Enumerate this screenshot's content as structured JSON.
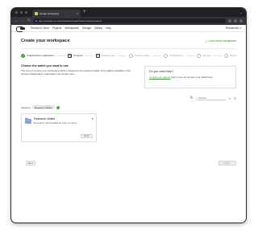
{
  "browser": {
    "tab_title": "Create workspace",
    "tab_close": "×",
    "new_tab": "+",
    "tab_menu": "⌄",
    "url": "app.example.com/workspaces/create?step=select-projects",
    "back": "←",
    "forward": "→",
    "reload": "↻"
  },
  "app": {
    "nav": [
      "Research Cloud",
      "Projects",
      "Workspaces",
      "Storage",
      "Gallery",
      "Help"
    ],
    "user": "Researcher",
    "user_caret": "▾"
  },
  "page": {
    "title": "Create your workspace",
    "help_link": "Learn about workspaces"
  },
  "stepper": {
    "steps": [
      {
        "label": "Collaborative organisation",
        "icon": "check",
        "state": "active"
      },
      {
        "label": "Projects",
        "icon": "grid",
        "state": "current"
      },
      {
        "label": "Catalog item",
        "icon": "",
        "state": "pending"
      },
      {
        "label": "Cloud provider",
        "icon": "",
        "state": "pending"
      },
      {
        "label": "Configuration",
        "icon": "",
        "state": "pending"
      },
      {
        "label": "Review",
        "icon": "",
        "state": "pending"
      },
      {
        "label": "Name",
        "icon": "",
        "state": "pending"
      }
    ]
  },
  "intro": {
    "title": "Choose the wallet you want to use",
    "text": "The cost of running your workspace will be charged to the selected wallet. Only wallets available in the chosen collaborative organisation are shown here."
  },
  "help": {
    "title": "Do you need help?",
    "link_text": "Contact our support",
    "text_after": " team if you do not see your wallet here."
  },
  "toolbar": {
    "refresh": "↻",
    "search_icon": "⌕",
    "search_text": "Search",
    "clear": "×",
    "filter": "⚲"
  },
  "selection": {
    "label": "Selected",
    "chip": "Research Wallet",
    "chip_remove": "×"
  },
  "card": {
    "title": "Research Wallet",
    "description": "Research Cloud wallet for team projects",
    "toggle": "▾",
    "button": "Select"
  },
  "footer": {
    "back": "Back",
    "next": "Next"
  }
}
